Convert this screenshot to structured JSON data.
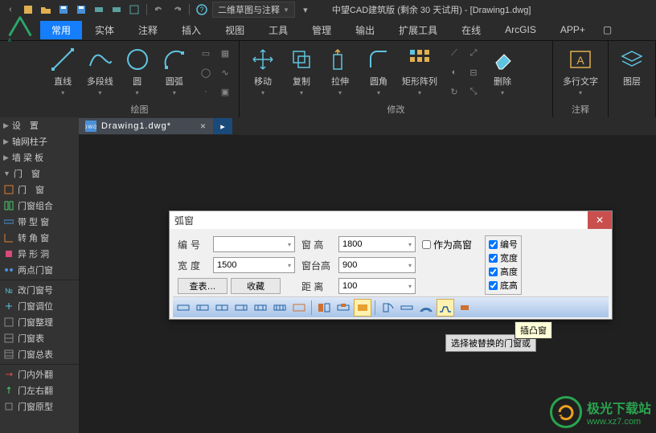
{
  "title": "中望CAD建筑版 (剩余 30 天试用) - [Drawing1.dwg]",
  "workspace": "二维草图与注释",
  "ribbonTabs": [
    "常用",
    "实体",
    "注释",
    "插入",
    "视图",
    "工具",
    "管理",
    "输出",
    "扩展工具",
    "在线",
    "ArcGIS",
    "APP+"
  ],
  "activeTab": "常用",
  "ribbonPanels": {
    "draw": {
      "title": "绘图",
      "tools": [
        "直线",
        "多段线",
        "圆",
        "圆弧"
      ]
    },
    "modify": {
      "title": "修改",
      "tools": [
        "移动",
        "复制",
        "拉伸",
        "圆角",
        "矩形阵列",
        "删除"
      ]
    },
    "annotate": {
      "title": "注释",
      "tools": [
        "多行文字"
      ]
    },
    "layer": {
      "title": "",
      "tools": [
        "图层"
      ]
    }
  },
  "docTab": {
    "name": "Drawing1.dwg*"
  },
  "leftPanel": {
    "items": [
      {
        "label": "设　置",
        "type": "header"
      },
      {
        "label": "轴网柱子",
        "type": "header"
      },
      {
        "label": "墙 梁 板",
        "type": "header"
      },
      {
        "label": "门　窗",
        "type": "header",
        "expanded": true
      },
      {
        "label": "门　窗",
        "icon": "door"
      },
      {
        "label": "门窗组合",
        "icon": "combo"
      },
      {
        "label": "带 型 窗",
        "icon": "band"
      },
      {
        "label": "转 角 窗",
        "icon": "corner"
      },
      {
        "label": "异 形 洞",
        "icon": "odd"
      },
      {
        "label": "两点门窗",
        "icon": "two"
      },
      {
        "sep": true
      },
      {
        "label": "改门窗号",
        "icon": "renum"
      },
      {
        "label": "门窗调位",
        "icon": "adjust"
      },
      {
        "label": "门窗整理",
        "icon": "sort"
      },
      {
        "label": "门窗表",
        "icon": "table"
      },
      {
        "label": "门窗总表",
        "icon": "sum"
      },
      {
        "sep": true
      },
      {
        "label": "门内外翻",
        "icon": "flip1"
      },
      {
        "label": "门左右翻",
        "icon": "flip2"
      },
      {
        "label": "门窗原型",
        "icon": "proto"
      }
    ]
  },
  "dialog": {
    "title": "弧窗",
    "labels": {
      "num": "编号",
      "width": "宽度",
      "height": "窗 高",
      "sill": "窗台高",
      "dist": "距 离",
      "lookup": "查表…",
      "fav": "收藏"
    },
    "values": {
      "num": "",
      "width": "1500",
      "height": "1800",
      "sill": "900",
      "dist": "100"
    },
    "asHigh": "作为高窗",
    "checks": [
      "编号",
      "宽度",
      "高度",
      "底高"
    ]
  },
  "tooltip": "插凸窗",
  "hint": "选择被替换的门窗或",
  "watermark": {
    "text": "极光下载站",
    "url": "www.xz7.com"
  }
}
